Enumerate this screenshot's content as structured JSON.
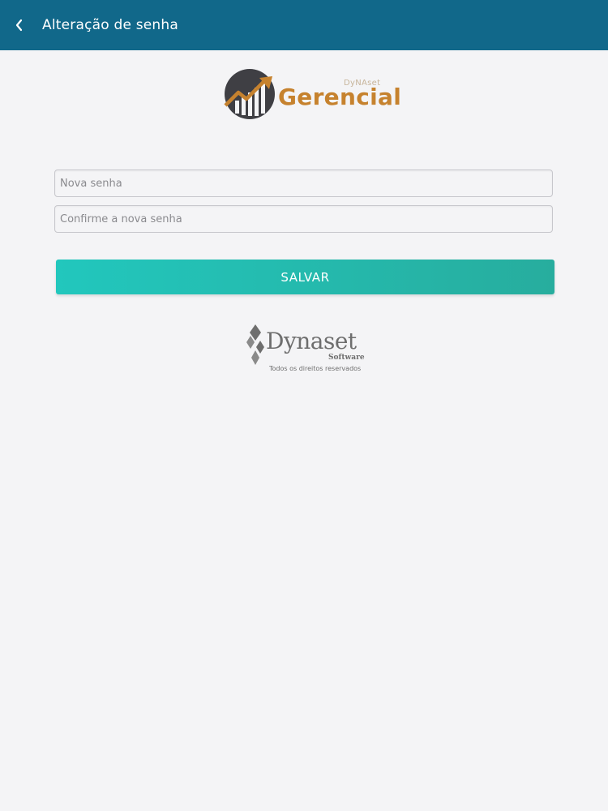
{
  "header": {
    "title": "Alteração de senha",
    "background": "#11688a"
  },
  "logo": {
    "brand_small": "DyNAset",
    "name": "Gerencial",
    "accent": "#c6822e"
  },
  "form": {
    "new_password_placeholder": "Nova senha",
    "confirm_password_placeholder": "Confirme a nova senha",
    "save_label": "SALVAR"
  },
  "footer": {
    "company": "Dynaset",
    "software": "Software",
    "rights": "Todos os direitos reservados"
  },
  "icons": {
    "back": "chevron-left-icon",
    "logo_mark": "growth-chart-icon",
    "dynaset_mark": "diamond-icon"
  }
}
